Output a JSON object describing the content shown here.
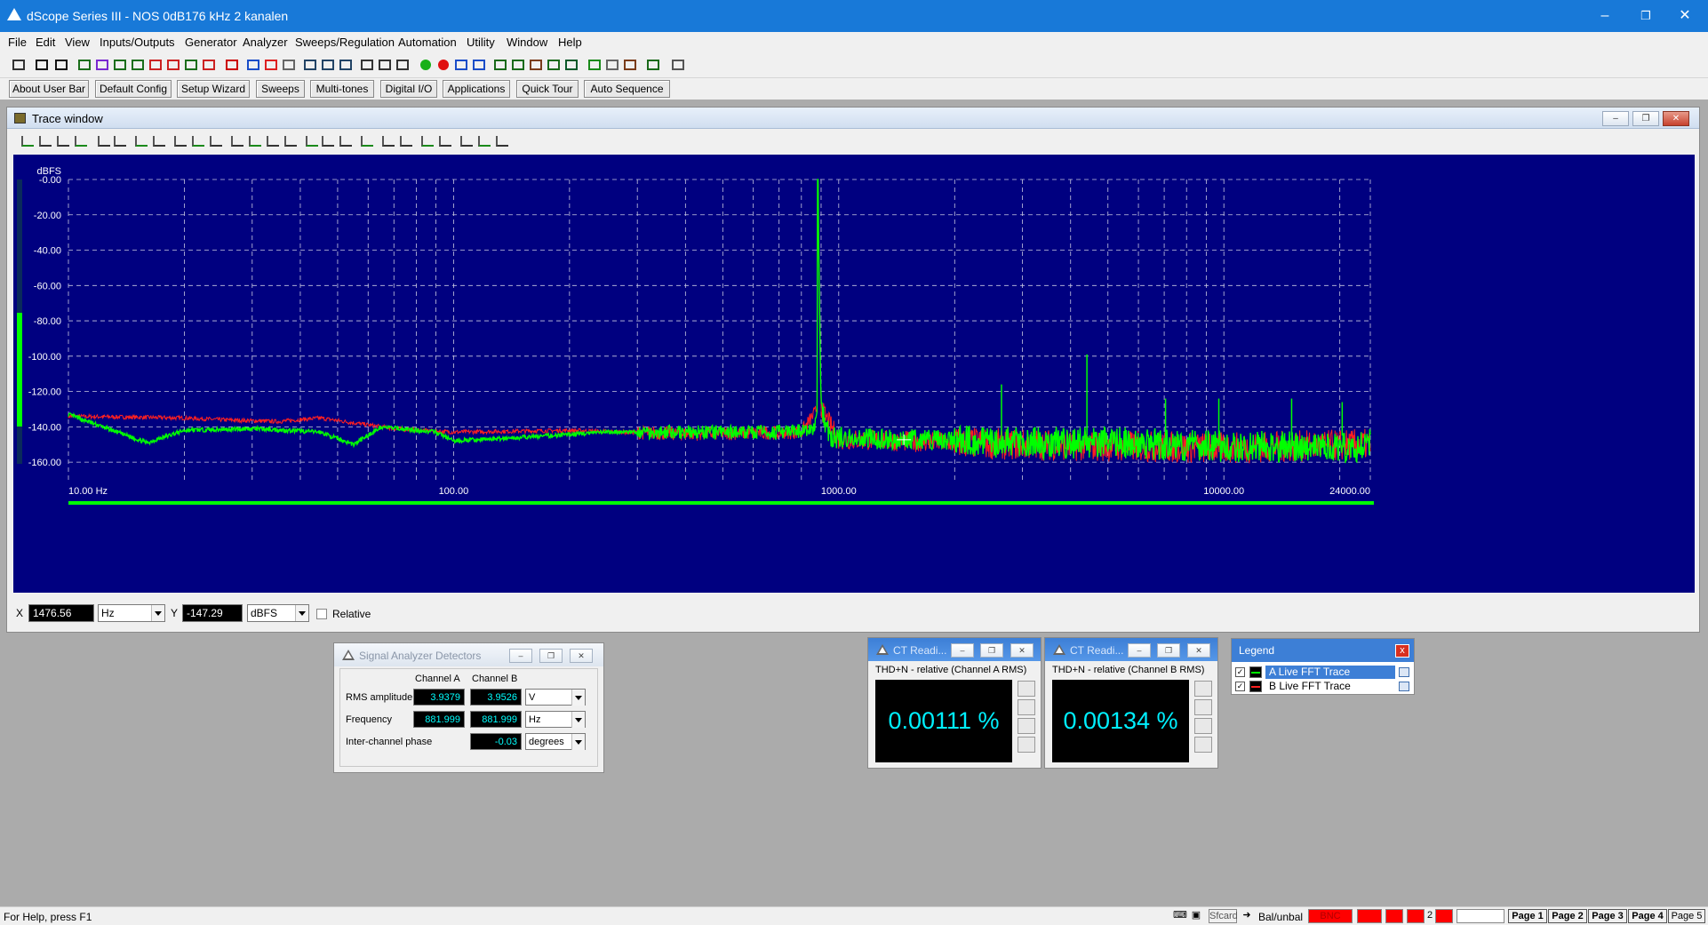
{
  "app": {
    "title": "dScope Series III - NOS 0dB176 kHz 2 kanalen"
  },
  "menu": [
    "File",
    "Edit",
    "View",
    "Inputs/Outputs",
    "Generator",
    "Analyzer",
    "Sweeps/Regulation",
    "Automation",
    "Utility",
    "Window",
    "Help"
  ],
  "user_bar": [
    "About User Bar",
    "Default Config",
    "Setup Wizard",
    "Sweeps",
    "Multi-tones",
    "Digital I/O",
    "Applications",
    "Quick Tour",
    "Auto Sequence"
  ],
  "trace_window": {
    "title": "Trace window",
    "readout": {
      "x_label": "X",
      "x_value": "1476.56",
      "x_unit": "Hz",
      "y_label": "Y",
      "y_value": "-147.29",
      "y_unit": "dBFS",
      "relative_label": "Relative"
    }
  },
  "chart_data": {
    "type": "line",
    "ylabel": "dBFS",
    "x_scale": "log",
    "xlim": [
      10,
      24000
    ],
    "ylim": [
      -170,
      0
    ],
    "y_ticks": [
      "-0.00",
      "-20.00",
      "-40.00",
      "-60.00",
      "-80.00",
      "-100.00",
      "-120.00",
      "-140.00",
      "-160.00"
    ],
    "x_ticks": [
      "10.00 Hz",
      "100.00",
      "1000.00",
      "10000.00",
      "24000.00"
    ],
    "grid": true,
    "series": [
      {
        "name": "A Live FFT Trace",
        "color": "#00ff00",
        "points": [
          [
            10,
            -133
          ],
          [
            13,
            -142
          ],
          [
            16,
            -149
          ],
          [
            20,
            -142
          ],
          [
            30,
            -141
          ],
          [
            45,
            -143
          ],
          [
            55,
            -150
          ],
          [
            65,
            -140
          ],
          [
            90,
            -143
          ],
          [
            100,
            -148
          ],
          [
            150,
            -146
          ],
          [
            250,
            -143
          ],
          [
            400,
            -143
          ],
          [
            700,
            -143
          ],
          [
            860,
            -142
          ],
          [
            881,
            -130
          ],
          [
            881.999,
            0
          ],
          [
            900,
            -130
          ],
          [
            950,
            -146
          ],
          [
            1500,
            -147
          ],
          [
            3000,
            -149
          ],
          [
            5000,
            -149
          ],
          [
            10000,
            -151
          ],
          [
            20000,
            -152
          ],
          [
            24000,
            -150
          ]
        ],
        "spurs": [
          [
            2646,
            -116
          ],
          [
            4410,
            -99
          ],
          [
            7056,
            -124
          ],
          [
            9702,
            -124
          ],
          [
            14994,
            -124
          ],
          [
            20286,
            -126
          ]
        ]
      },
      {
        "name": "B Live FFT Trace",
        "color": "#ff2020",
        "points": [
          [
            10,
            -134
          ],
          [
            20,
            -135
          ],
          [
            25,
            -136
          ],
          [
            35,
            -137
          ],
          [
            45,
            -135
          ],
          [
            70,
            -141
          ],
          [
            100,
            -143
          ],
          [
            200,
            -142
          ],
          [
            400,
            -144
          ],
          [
            800,
            -143
          ],
          [
            881,
            -130
          ],
          [
            881.999,
            -1
          ],
          [
            900,
            -130
          ],
          [
            1000,
            -147
          ],
          [
            3000,
            -150
          ],
          [
            10000,
            -152
          ],
          [
            24000,
            -150
          ]
        ]
      }
    ]
  },
  "detectors": {
    "title": "Signal Analyzer Detectors",
    "col_a": "Channel A",
    "col_b": "Channel B",
    "rows": [
      {
        "label": "RMS amplitude",
        "a": "3.9379",
        "b": "3.9526",
        "unit": "V"
      },
      {
        "label": "Frequency",
        "a": "881.999",
        "b": "881.999",
        "unit": "Hz"
      },
      {
        "label": "Inter-channel phase",
        "a": "",
        "b": "-0.03",
        "unit": "degrees"
      }
    ]
  },
  "ct_a": {
    "title": "CT Readi...",
    "caption": "THD+N - relative (Channel A RMS)",
    "value": "0.00111 %"
  },
  "ct_b": {
    "title": "CT Readi...",
    "caption": "THD+N - relative (Channel B RMS)",
    "value": "0.00134 %"
  },
  "legend": {
    "title": "Legend",
    "close": "x",
    "items": [
      {
        "label": "A  Live FFT Trace",
        "color": "#00ff00",
        "selected": true
      },
      {
        "label": "B  Live FFT Trace",
        "color": "#ff2020",
        "selected": false
      }
    ]
  },
  "status": {
    "help": "For Help, press F1",
    "balunbal": "Bal/unbal",
    "bnc": "BNC",
    "sfcard": "Sfcard",
    "num": "2",
    "pages": [
      "Page 1",
      "Page 2",
      "Page 3",
      "Page 4",
      "Page 5"
    ]
  }
}
